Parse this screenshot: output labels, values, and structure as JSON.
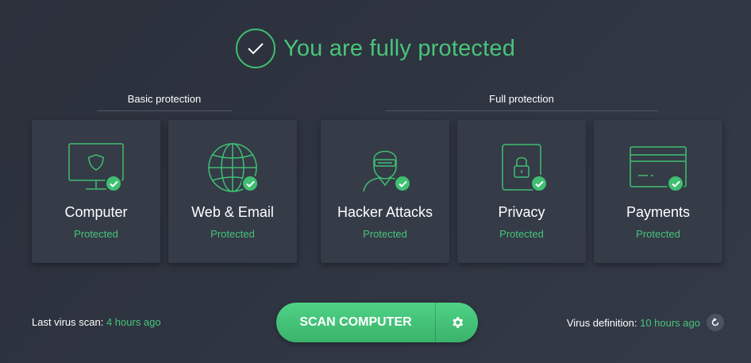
{
  "header": {
    "title": "You are fully protected"
  },
  "groups": {
    "basic": "Basic protection",
    "full": "Full protection"
  },
  "cards": [
    {
      "title": "Computer",
      "status": "Protected",
      "icon": "monitor-shield-icon"
    },
    {
      "title": "Web & Email",
      "status": "Protected",
      "icon": "globe-icon"
    },
    {
      "title": "Hacker Attacks",
      "status": "Protected",
      "icon": "hacker-icon"
    },
    {
      "title": "Privacy",
      "status": "Protected",
      "icon": "lock-icon"
    },
    {
      "title": "Payments",
      "status": "Protected",
      "icon": "credit-card-icon"
    }
  ],
  "footer": {
    "last_scan_label": "Last virus scan:",
    "last_scan_value": "4 hours ago",
    "virus_def_label": "Virus definition:",
    "virus_def_value": "10 hours ago"
  },
  "scan_button": {
    "label": "SCAN COMPUTER"
  },
  "colors": {
    "accent": "#48c47a",
    "background": "#2e3440",
    "card": "#353b47"
  }
}
